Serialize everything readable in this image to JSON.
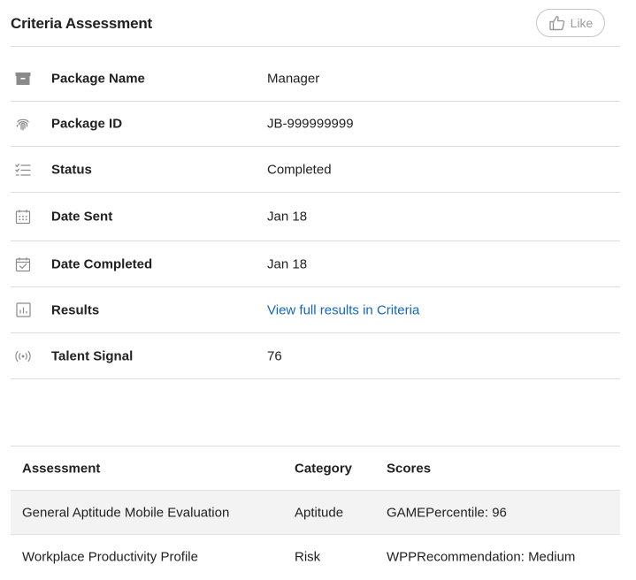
{
  "header": {
    "title": "Criteria Assessment",
    "like_label": "Like"
  },
  "details": [
    {
      "icon": "archive-box-icon",
      "label": "Package Name",
      "value": "Manager"
    },
    {
      "icon": "fingerprint-icon",
      "label": "Package ID",
      "value": "JB-999999999"
    },
    {
      "icon": "checklist-icon",
      "label": "Status",
      "value": "Completed"
    },
    {
      "icon": "calendar-icon",
      "label": "Date Sent",
      "value": "Jan 18"
    },
    {
      "icon": "calendar-check-icon",
      "label": "Date Completed",
      "value": "Jan 18"
    },
    {
      "icon": "bar-chart-icon",
      "label": "Results",
      "value": "View full results in Criteria"
    },
    {
      "icon": "signal-broadcast-icon",
      "label": "Talent Signal",
      "value": "76"
    }
  ],
  "table": {
    "headers": [
      "Assessment",
      "Category",
      "Scores"
    ],
    "rows": [
      [
        "General Aptitude Mobile Evaluation",
        "Aptitude",
        "GAMEPercentile: 96"
      ],
      [
        "Workplace Productivity Profile",
        "Risk",
        "WPPRecommendation: Medium"
      ]
    ]
  },
  "colors": {
    "link": "#1565c0",
    "divider": "#dcdcdc",
    "shaded_row": "#f3f3f3"
  }
}
